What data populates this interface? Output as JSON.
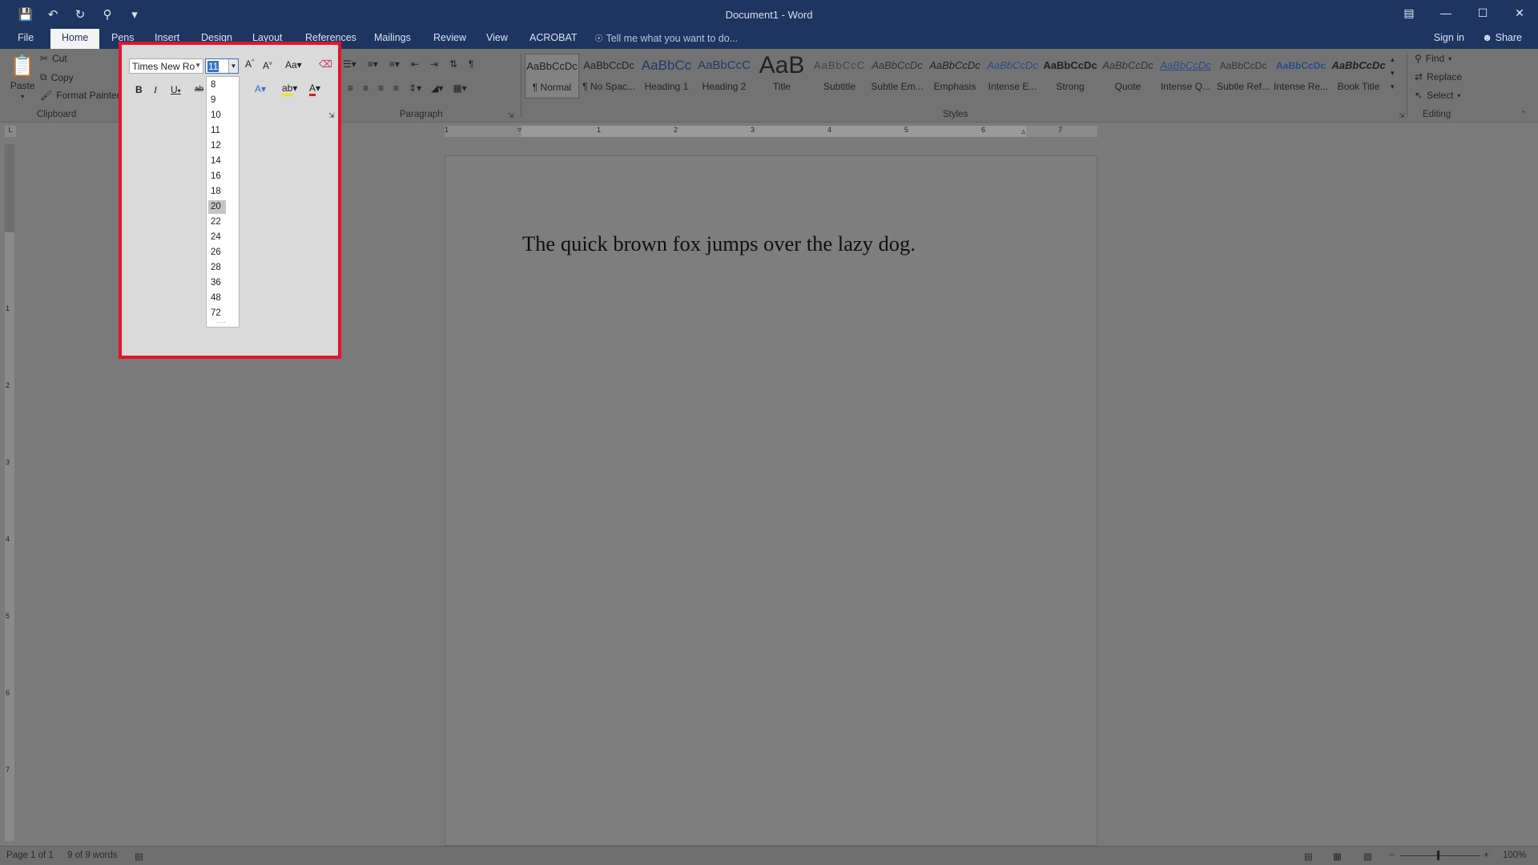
{
  "window": {
    "title": "Document1 - Word"
  },
  "qat": {
    "save_icon": "save-icon",
    "undo_icon": "undo-icon",
    "redo_icon": "redo-icon",
    "find_icon": "find-icon",
    "customize_icon": "customize-icon"
  },
  "tabs": [
    "File",
    "Home",
    "Pens",
    "Insert",
    "Design",
    "Layout",
    "References",
    "Mailings",
    "Review",
    "View",
    "ACROBAT"
  ],
  "tell_me": "Tell me what you want to do...",
  "account": {
    "sign_in": "Sign in",
    "share": "Share"
  },
  "clipboard": {
    "paste": "Paste",
    "cut": "Cut",
    "copy": "Copy",
    "format_painter": "Format Painter",
    "group": "Clipboard"
  },
  "font": {
    "name": "Times New Ro",
    "size": "11"
  },
  "font_sizes": [
    "8",
    "9",
    "10",
    "11",
    "12",
    "14",
    "16",
    "18",
    "20",
    "22",
    "24",
    "26",
    "28",
    "36",
    "48",
    "72"
  ],
  "font_size_highlighted": "20",
  "paragraph": {
    "group": "Paragraph"
  },
  "styles": {
    "group": "Styles",
    "items": [
      {
        "preview": "AaBbCcDc",
        "name": "¶ Normal"
      },
      {
        "preview": "AaBbCcDc",
        "name": "¶ No Spac..."
      },
      {
        "preview": "AaBbCc",
        "name": "Heading 1"
      },
      {
        "preview": "AaBbCcC",
        "name": "Heading 2"
      },
      {
        "preview": "AaB",
        "name": "Title"
      },
      {
        "preview": "AaBbCcC",
        "name": "Subtitle"
      },
      {
        "preview": "AaBbCcDc",
        "name": "Subtle Em..."
      },
      {
        "preview": "AaBbCcDc",
        "name": "Emphasis"
      },
      {
        "preview": "AaBbCcDc",
        "name": "Intense E..."
      },
      {
        "preview": "AaBbCcDc",
        "name": "Strong"
      },
      {
        "preview": "AaBbCcDc",
        "name": "Quote"
      },
      {
        "preview": "AaBbCcDc",
        "name": "Intense Q..."
      },
      {
        "preview": "AaBbCcDc",
        "name": "Subtle Ref..."
      },
      {
        "preview": "AaBbCcDc",
        "name": "Intense Re..."
      },
      {
        "preview": "AaBbCcDc",
        "name": "Book Title"
      }
    ]
  },
  "editing": {
    "group": "Editing",
    "find": "Find",
    "replace": "Replace",
    "select": "Select"
  },
  "ruler": {
    "h_numbers": [
      "1",
      "1",
      "2",
      "3",
      "4",
      "5",
      "6",
      "7"
    ],
    "v_numbers": [
      "1",
      "2",
      "3",
      "4",
      "5",
      "6",
      "7"
    ]
  },
  "document": {
    "text": "The quick brown fox jumps over the lazy dog."
  },
  "status": {
    "page": "Page 1 of 1",
    "words": "9 of 9 words",
    "zoom": "100%"
  },
  "colors": {
    "titlebar": "#1e3561",
    "highlight_border": "#e3142b",
    "selection": "#3b73c6"
  }
}
